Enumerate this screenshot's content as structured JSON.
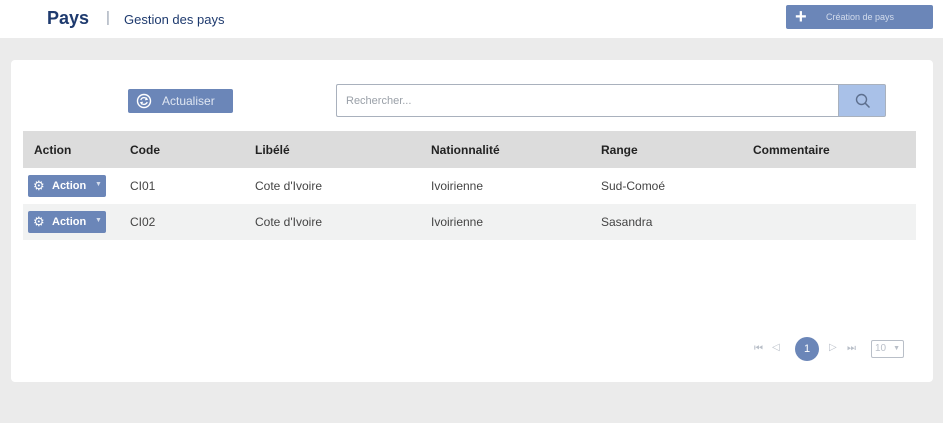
{
  "header": {
    "title": "Pays",
    "separator": "|",
    "subtitle": "Gestion des pays",
    "create_button": "Création de pays"
  },
  "toolbar": {
    "refresh_label": "Actualiser",
    "search_placeholder": "Rechercher..."
  },
  "table": {
    "columns": [
      "Action",
      "Code",
      "Libélé",
      "Nationnalité",
      "Range",
      "Commentaire"
    ],
    "action_label": "Action",
    "rows": [
      {
        "code": "CI01",
        "libele": "Cote d'Ivoire",
        "nationalite": "Ivoirienne",
        "range": "Sud-Comoé",
        "commentaire": ""
      },
      {
        "code": "CI02",
        "libele": "Cote d'Ivoire",
        "nationalite": "Ivoirienne",
        "range": "Sasandra",
        "commentaire": ""
      }
    ]
  },
  "pagination": {
    "current_page": "1",
    "page_size": "10"
  },
  "colors": {
    "primary": "#6b86b8",
    "title": "#1e3a6e",
    "header_bg": "#dcdcdc",
    "search_button": "#a9c1e8"
  },
  "icons": {
    "create": "plus-icon",
    "refresh": "refresh-icon",
    "search": "search-icon",
    "action": "gear-icon",
    "dropdown": "chevron-down-icon",
    "first": "first-page-icon",
    "prev": "previous-page-icon",
    "next": "next-page-icon",
    "last": "last-page-icon"
  }
}
